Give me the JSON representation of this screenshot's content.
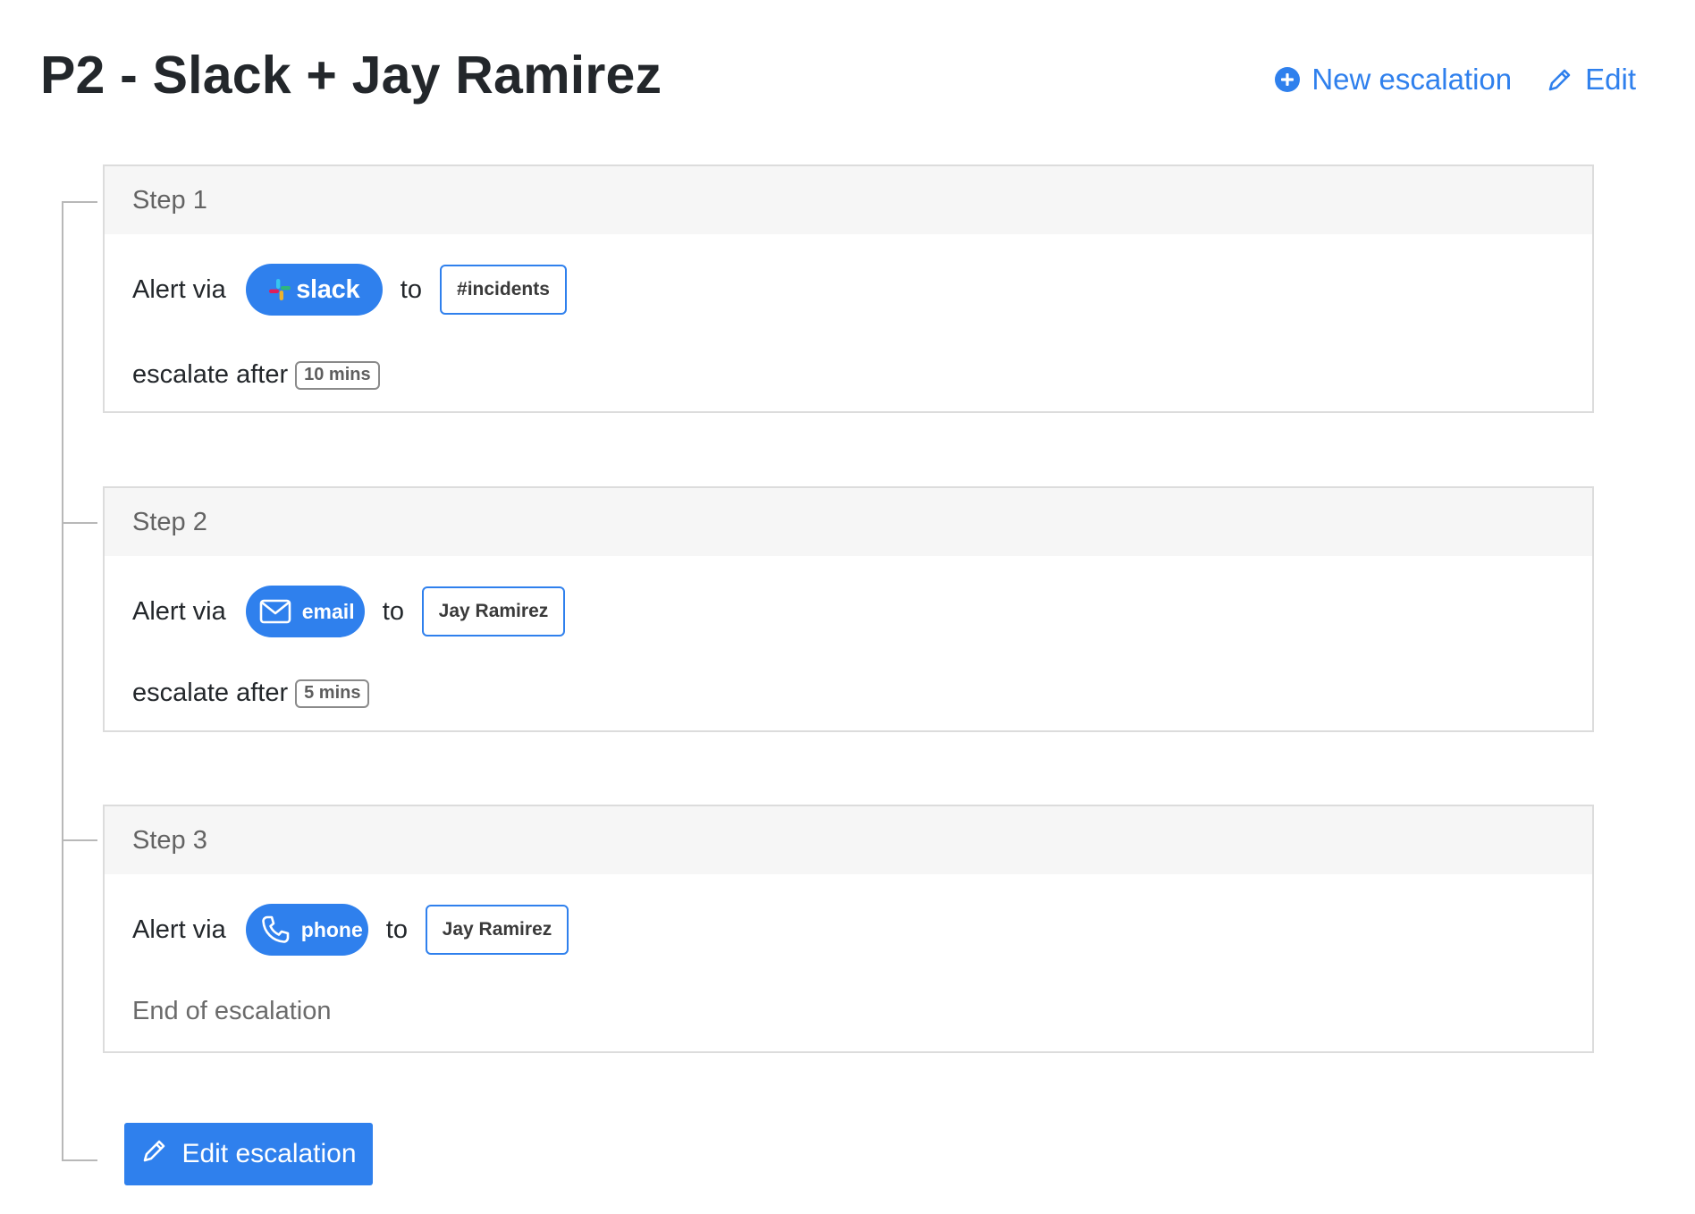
{
  "header": {
    "title": "P2 - Slack + Jay Ramirez",
    "new_escalation_label": "New escalation",
    "edit_label": "Edit"
  },
  "steps": [
    {
      "title": "Step 1",
      "alert_label": "Alert via",
      "channel": "slack",
      "channel_icon": "slack-logo-icon",
      "to_label": "to",
      "target": "#incidents",
      "escalate_label": "escalate after",
      "escalate_after": "10 mins"
    },
    {
      "title": "Step 2",
      "alert_label": "Alert via",
      "channel": "email",
      "channel_icon": "mail-icon",
      "to_label": "to",
      "target": "Jay Ramirez",
      "escalate_label": "escalate after",
      "escalate_after": "5 mins"
    },
    {
      "title": "Step 3",
      "alert_label": "Alert via",
      "channel": "phone",
      "channel_icon": "phone-icon",
      "to_label": "to",
      "target": "Jay Ramirez",
      "end_label": "End of escalation"
    }
  ],
  "footer": {
    "edit_escalation_label": "Edit escalation"
  },
  "colors": {
    "accent": "#2f80ed",
    "header_bg": "#f6f6f6",
    "border": "#dcdcdc"
  }
}
